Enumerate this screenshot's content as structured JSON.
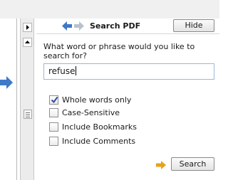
{
  "header": {
    "title": "Search PDF",
    "hide_label": "Hide"
  },
  "search": {
    "prompt": "What word or phrase would you like to search for?",
    "query": "refuse",
    "button_label": "Search"
  },
  "options": [
    {
      "label": "Whole words only",
      "checked": true
    },
    {
      "label": "Case-Sensitive",
      "checked": false
    },
    {
      "label": "Include Bookmarks",
      "checked": false
    },
    {
      "label": "Include Comments",
      "checked": false
    }
  ],
  "icons": {
    "side_arrow": "arrow-right-icon",
    "back": "arrow-left-icon",
    "forward": "arrow-right-icon",
    "go": "arrow-right-icon"
  },
  "colors": {
    "arrow_blue": "#3f78c8",
    "arrow_gray": "#b9c2cc",
    "arrow_orange": "#e8a21a",
    "check": "#2e4c9c"
  }
}
